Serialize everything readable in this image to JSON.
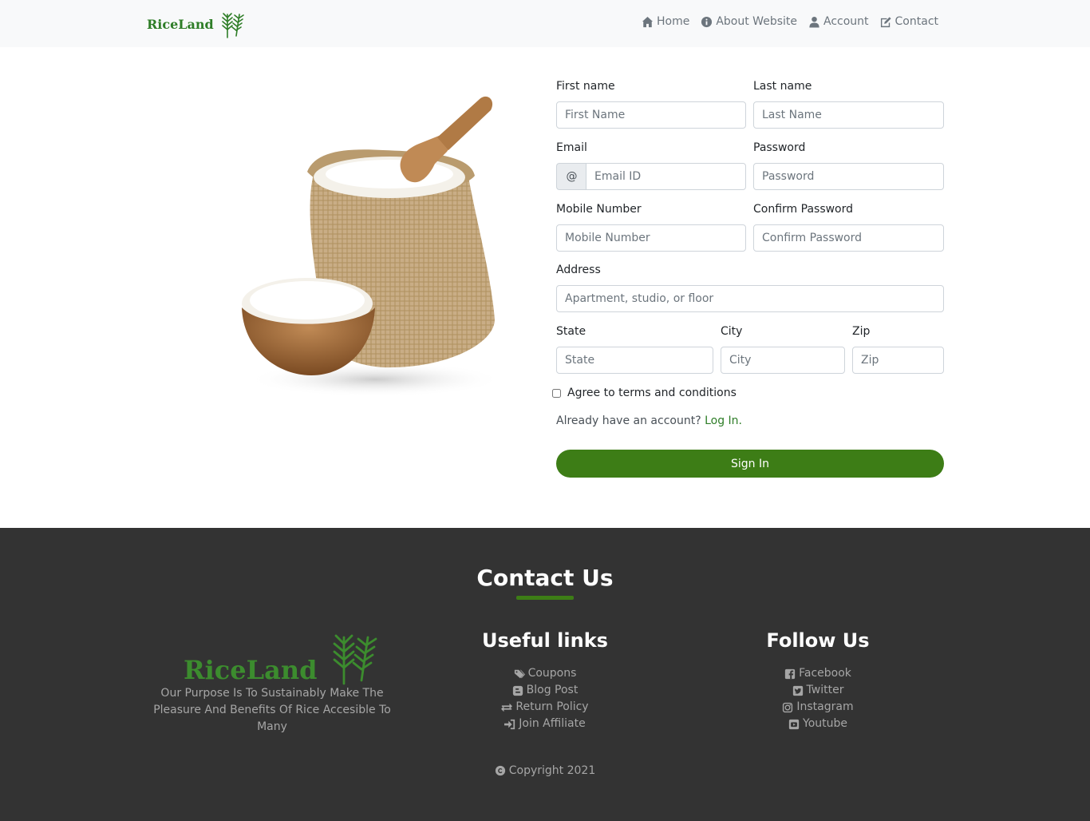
{
  "navbar": {
    "brand": "RiceLand",
    "links": [
      {
        "label": "Home",
        "icon": "home-icon"
      },
      {
        "label": "About Website",
        "icon": "info-icon"
      },
      {
        "label": "Account",
        "icon": "user-icon"
      },
      {
        "label": "Contact",
        "icon": "edit-icon"
      }
    ]
  },
  "form": {
    "first_name": {
      "label": "First name",
      "placeholder": "First Name"
    },
    "last_name": {
      "label": "Last name",
      "placeholder": "Last Name"
    },
    "email": {
      "label": "Email",
      "addon": "@",
      "placeholder": "Email ID"
    },
    "password": {
      "label": "Password",
      "placeholder": "Password"
    },
    "mobile": {
      "label": "Mobile Number",
      "placeholder": "Mobile Number"
    },
    "confirm_password": {
      "label": "Confirm Password",
      "placeholder": "Confirm Password"
    },
    "address": {
      "label": "Address",
      "placeholder": "Apartment, studio, or floor"
    },
    "state": {
      "label": "State",
      "placeholder": "State"
    },
    "city": {
      "label": "City",
      "placeholder": "City"
    },
    "zip": {
      "label": "Zip",
      "placeholder": "Zip"
    },
    "terms": "Agree to terms and conditions",
    "login_prompt": "Already have an account?",
    "login_link": "Log In.",
    "submit": "Sign In"
  },
  "footer": {
    "title": "Contact Us",
    "brand": "RiceLand",
    "purpose": "Our Purpose Is To Sustainably Make The Pleasure And Benefits Of Rice Accesible To Many",
    "useful_links": {
      "title": "Useful links",
      "items": [
        {
          "label": "Coupons",
          "icon": "tags-icon"
        },
        {
          "label": "Blog Post",
          "icon": "blogger-icon"
        },
        {
          "label": "Return Policy",
          "icon": "exchange-icon"
        },
        {
          "label": "Join Affiliate",
          "icon": "sign-in-icon"
        }
      ]
    },
    "follow_us": {
      "title": "Follow Us",
      "items": [
        {
          "label": "Facebook",
          "icon": "facebook-icon"
        },
        {
          "label": "Twitter",
          "icon": "twitter-icon"
        },
        {
          "label": "Instagram",
          "icon": "instagram-icon"
        },
        {
          "label": "Youtube",
          "icon": "youtube-icon"
        }
      ]
    },
    "copyright": "Copyright 2021"
  },
  "colors": {
    "brand_green": "#2e7d27",
    "button_green": "#3d7d16",
    "footer_bg": "#333333",
    "navbar_bg": "#f8f9fa"
  }
}
